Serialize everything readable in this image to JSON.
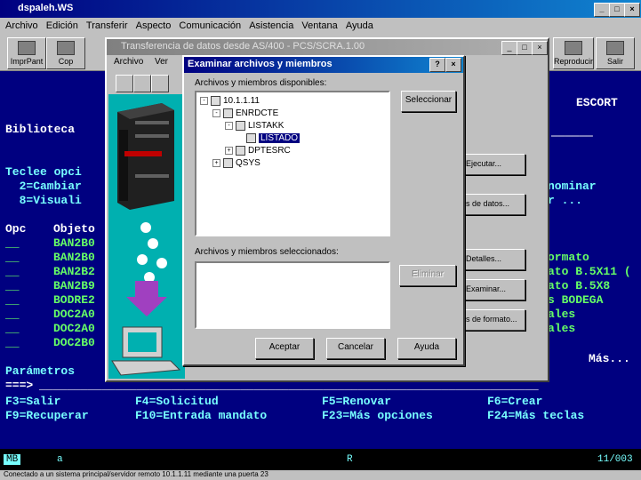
{
  "main_window": {
    "title": "dspaleh.WS",
    "menu": [
      "Archivo",
      "Edición",
      "Transferir",
      "Aspecto",
      "Comunicación",
      "Asistencia",
      "Ventana",
      "Ayuda"
    ],
    "toolbar_left": [
      "ImprPant",
      "Cop"
    ],
    "toolbar_right": [
      "Reproducir",
      "Salir"
    ]
  },
  "terminal": {
    "escort": "ESCORT",
    "biblioteca": "Biblioteca",
    "teclee": "Teclee opci",
    "opt2": "  2=Cambiar",
    "opt8": "  8=Visuali",
    "header_opc": "Opc",
    "header_objeto": "Objeto",
    "objects": [
      "BAN2B0",
      "BAN2B0",
      "BAN2B2",
      "BAN2B9",
      "BODRE2",
      "DOC2A0",
      "DOC2A0",
      "DOC2B0"
    ],
    "right_nominar": "nominar",
    "right_r": "r ...",
    "right_col": [
      "ormato",
      "ato B.5X11 (",
      "ato B.5X8",
      "s BODEGA",
      "ales",
      "ales"
    ],
    "mas": "Más...",
    "parametros": "Parámetros",
    "prompt": "===>",
    "f3": "F3=Salir",
    "f4": "F4=Solicitud",
    "f5": "F5=Renovar",
    "f6": "F6=Crear",
    "f9": "F9=Recuperar",
    "f10": "F10=Entrada mandato",
    "f23": "F23=Más opciones",
    "f24": "F24=Más teclas"
  },
  "status": {
    "left": "MB",
    "a": "a",
    "mid": "R",
    "right": "11/003",
    "bottom": "Conectado a un sistema principal/servidor remoto 10.1.1.11 mediante una puerta 23"
  },
  "transfer_window": {
    "title": "Transferencia de datos desde AS/400 - PCS/SCRA.1.00",
    "menu": [
      "Archivo",
      "Ver"
    ],
    "side_buttons": [
      "Ejecutar...",
      "s de datos...",
      "Detalles...",
      "Examinar...",
      "s de formato..."
    ]
  },
  "dialog": {
    "title": "Examinar archivos y miembros",
    "available_label": "Archivos y miembros disponibles:",
    "select_button": "Seleccionar",
    "tree": [
      {
        "label": "10.1.1.11",
        "pm": "-"
      },
      {
        "label": "ENRDCTE",
        "pm": "-"
      },
      {
        "label": "LISTAKK",
        "pm": "-"
      },
      {
        "label": "LISTADO",
        "pm": ""
      },
      {
        "label": "DPTESRC",
        "pm": "+"
      },
      {
        "label": "QSYS",
        "pm": "+"
      }
    ],
    "selected_label": "Archivos y miembros seleccionados:",
    "remove_button": "Eliminar",
    "accept_button": "Aceptar",
    "cancel_button": "Cancelar",
    "help_button": "Ayuda"
  }
}
